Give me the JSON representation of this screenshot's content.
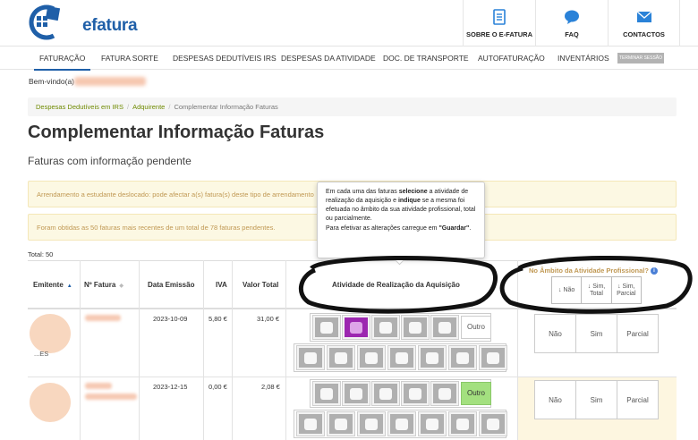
{
  "header": {
    "logo_text": "efatura",
    "links": [
      {
        "label": "SOBRE O E-FATURA",
        "icon": "document-icon"
      },
      {
        "label": "FAQ",
        "icon": "speech-bubble-icon"
      },
      {
        "label": "CONTACTOS",
        "icon": "envelope-icon"
      }
    ]
  },
  "nav": {
    "items": [
      "FATURAÇÃO",
      "FATURA SORTE",
      "DESPESAS DEDUTÍVEIS IRS",
      "DESPESAS DA ATIVIDADE",
      "DOC. DE TRANSPORTE",
      "AUTOFATURAÇÃO",
      "INVENTÁRIOS"
    ],
    "logout": "TERMINAR SESSÃO"
  },
  "welcome": "Bem-vindo(a)",
  "breadcrumb": {
    "items": [
      "Despesas Dedutíveis em IRS",
      "Adquirente"
    ],
    "current": "Complementar Informação Faturas"
  },
  "page_title": "Complementar Informação Faturas",
  "subtitle": "Faturas com informação pendente",
  "alerts": {
    "first": "Arrendamento a estudante deslocado: pode afectar a(s) fatura(s) deste tipo de arrendamento",
    "second": "Foram obtidas as 50 faturas mais recentes de um total de 78 faturas pendentes."
  },
  "total": "Total: 50",
  "tooltip": {
    "p1": "Em cada uma das faturas ",
    "b1": "selecione",
    "p2": " a atividade de realização da aquisição e ",
    "b2": "indique",
    "p3": " se a mesma foi efetuada no âmbito da sua atividade profissional, total ou parcialmente.",
    "p4": "Para efetivar as alterações carregue em ",
    "b3": "\"Guardar\"",
    "p5": "."
  },
  "table": {
    "headers": {
      "emitente": "Emitente",
      "n_fatura": "Nº Fatura",
      "data": "Data Emissão",
      "iva": "IVA",
      "valor": "Valor Total",
      "atividade": "Atividade de Realização da Aquisição",
      "ambito": "No Âmbito da Atividade Profissional?"
    },
    "ambito_header_options": [
      "Não",
      "Sim, Total",
      "Sim, Parcial"
    ],
    "rows": [
      {
        "data": "2023-10-09",
        "iva": "5,80 €",
        "valor": "31,00 €",
        "emitente_suffix": "...ES",
        "outro": "Outro",
        "selected_icon": 1
      },
      {
        "data": "2023-12-15",
        "iva": "0,00 €",
        "valor": "2,08 €",
        "emitente_suffix": "",
        "outro": "Outro",
        "outro_selected": true
      }
    ],
    "ambito_options": [
      "Não",
      "Sim",
      "Parcial"
    ]
  },
  "colors": {
    "brand": "#1f5fa8",
    "selected_activity": "#9c27b0",
    "outro_selected": "#a3e07f",
    "alert_bg": "#fcf8e3",
    "alert_text": "#c09853",
    "breadcrumb_link": "#6f8a00"
  }
}
